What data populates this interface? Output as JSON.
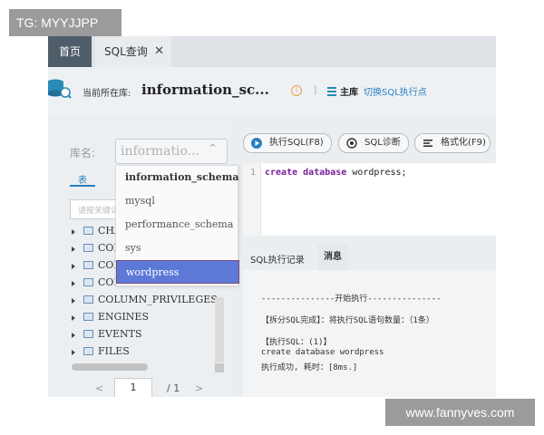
{
  "watermarks": {
    "top_left": "TG: MYYJJPP",
    "bottom_right": "www.fannyves.com"
  },
  "tabs": {
    "home": "首页",
    "sql": "SQL查询",
    "close": "✕"
  },
  "header": {
    "current_db_label": "当前所在库:",
    "current_db_value": "information_sc...",
    "separator": "|",
    "main_label": "主库",
    "switch_link": "切换SQL执行点"
  },
  "left": {
    "lib_label": "库名:",
    "lib_select_value": "informatio...",
    "lib_chevron": "⌃",
    "tab_table": "表",
    "search_placeholder": "请按关键词",
    "tree": [
      "CHA",
      "COL",
      "COL",
      "COLUMNS",
      "COLUMN_PRIVILEGES",
      "ENGINES",
      "EVENTS",
      "FILES"
    ],
    "pager": {
      "prev": "<",
      "page": "1",
      "total": "/ 1",
      "next": ">"
    }
  },
  "dropdown": [
    "information_schema",
    "mysql",
    "performance_schema",
    "sys",
    "wordpress"
  ],
  "toolbar": {
    "run": "执行SQL(F8)",
    "diagnose": "SQL诊断",
    "format": "格式化(F9)"
  },
  "editor": {
    "line": "1",
    "kw1": "create",
    "kw2": "database",
    "rest": " wordpress;"
  },
  "results": {
    "tab_history": "SQL执行记录",
    "tab_message": "消息",
    "log": [
      "---------------开始执行---------------",
      "【拆分SQL完成】：将执行SQL语句数量：（1条）",
      "【执行SQL：(1)】",
      "create database wordpress",
      "执行成功, 耗时：[8ms.]"
    ]
  },
  "colors": {
    "accent": "#2b7fc0",
    "dropdown_highlight": "#5d79d8",
    "tab_dark": "#4f5c69"
  }
}
